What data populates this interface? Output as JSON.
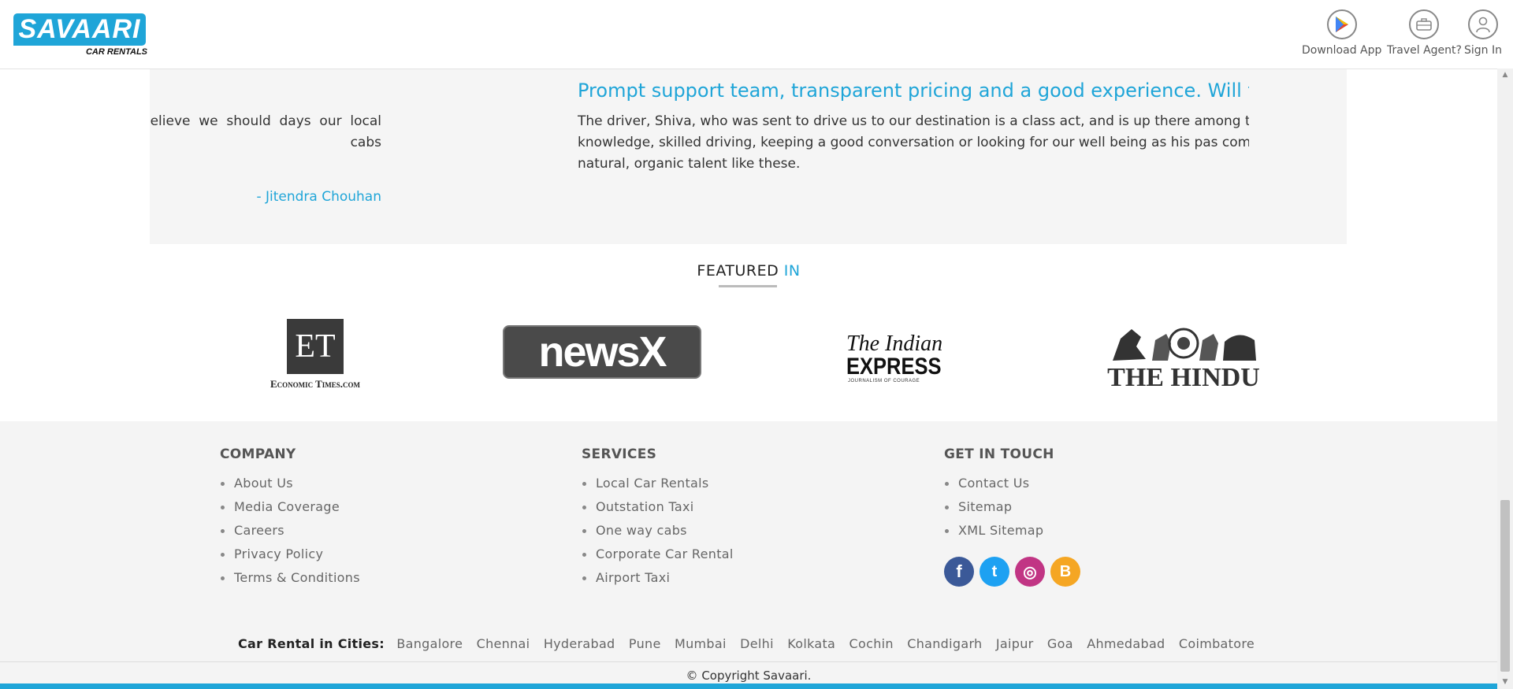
{
  "brand": {
    "name": "SAVAARI",
    "tagline": "CAR RENTALS"
  },
  "header_actions": [
    {
      "label": "Download App",
      "icon": "play-store-icon"
    },
    {
      "label": "Travel Agent?",
      "icon": "briefcase-icon"
    },
    {
      "label": "Sign In",
      "icon": "user-icon"
    }
  ],
  "testimonial_prev": {
    "text": "I believe we should days our local cabs",
    "author": "- Jitendra Chouhan"
  },
  "testimonial_current": {
    "title": "Prompt support team, transparent pricing and a good experience. Will tr",
    "body": "The driver, Shiva, who was sent to drive us to our destination is a class act, and is up there among the local knowledge, skilled driving, keeping a good conversation or looking for our well being as his pas company nurtures natural, organic talent like these."
  },
  "featured": {
    "title_main": "FEATURED",
    "title_accent": "IN",
    "logos": [
      {
        "name": "Economic Times",
        "line1": "ET",
        "line2": "Economic Times.com"
      },
      {
        "name": "NewsX",
        "text": "newsX"
      },
      {
        "name": "The Indian Express",
        "line1": "The Indian",
        "line2": "EXPRESS",
        "line3": "JOURNALISM OF COURAGE"
      },
      {
        "name": "The Hindu",
        "text": "THE HINDU"
      }
    ]
  },
  "footer": {
    "company": {
      "heading": "COMPANY",
      "links": [
        "About Us",
        "Media Coverage",
        "Careers",
        "Privacy Policy",
        "Terms & Conditions"
      ]
    },
    "services": {
      "heading": "SERVICES",
      "links": [
        "Local Car Rentals",
        "Outstation Taxi",
        "One way cabs",
        "Corporate Car Rental",
        "Airport Taxi"
      ]
    },
    "contact": {
      "heading": "GET IN TOUCH",
      "links": [
        "Contact Us",
        "Sitemap",
        "XML Sitemap"
      ]
    },
    "social": [
      {
        "icon": "facebook-icon",
        "glyph": "f",
        "color": "#3b5998"
      },
      {
        "icon": "twitter-icon",
        "glyph": "t",
        "color": "#1da1f2"
      },
      {
        "icon": "instagram-icon",
        "glyph": "◎",
        "color": "#c13584"
      },
      {
        "icon": "blogger-icon",
        "glyph": "B",
        "color": "#f5a623"
      }
    ],
    "cities_label": "Car Rental in Cities:",
    "cities": [
      "Bangalore",
      "Chennai",
      "Hyderabad",
      "Pune",
      "Mumbai",
      "Delhi",
      "Kolkata",
      "Cochin",
      "Chandigarh",
      "Jaipur",
      "Goa",
      "Ahmedabad",
      "Coimbatore"
    ],
    "copyright": "© Copyright Savaari."
  },
  "colors": {
    "accent": "#1fa5d8",
    "footer_bg": "#f4f4f4",
    "testimonial_bg": "#f5f5f5"
  }
}
